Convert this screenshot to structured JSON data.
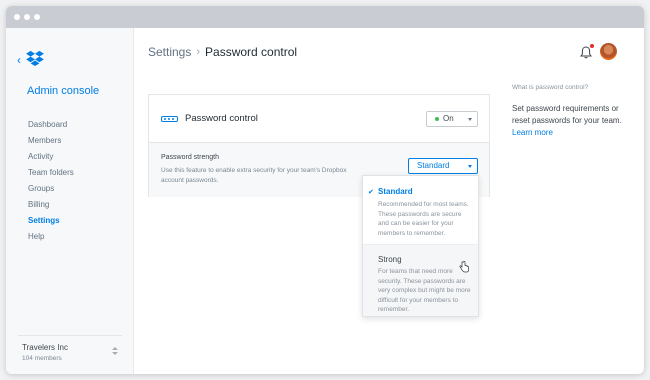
{
  "sidebar": {
    "admin_title": "Admin console",
    "items": [
      {
        "label": "Dashboard"
      },
      {
        "label": "Members"
      },
      {
        "label": "Activity"
      },
      {
        "label": "Team folders"
      },
      {
        "label": "Groups"
      },
      {
        "label": "Billing"
      },
      {
        "label": "Settings",
        "active": true
      },
      {
        "label": "Help"
      }
    ],
    "team": {
      "name": "Travelers Inc",
      "members": "104 members"
    }
  },
  "header": {
    "breadcrumb_parent": "Settings",
    "breadcrumb_separator": "›",
    "breadcrumb_current": "Password control"
  },
  "card": {
    "title": "Password control",
    "toggle_value": "On",
    "strength_label": "Password strength",
    "strength_description": "Use this feature to enable extra security for your team's Dropbox account passwords.",
    "strength_selected": "Standard"
  },
  "dropdown": {
    "options": [
      {
        "title": "Standard",
        "description": "Recommended for most teams. These passwords are secure and can be easier for your members to remember.",
        "selected": true
      },
      {
        "title": "Strong",
        "description": "For teams that need more security. These passwords are very complex but might be more difficult for your members to remember.",
        "selected": false
      }
    ],
    "check_glyph": "✔"
  },
  "help": {
    "question": "What is password control?",
    "text": "Set password requirements or reset passwords for your team.",
    "link": "Learn more"
  },
  "colors": {
    "accent": "#007ee5",
    "status_on": "#3ebe55",
    "notification": "#e02e2e"
  }
}
